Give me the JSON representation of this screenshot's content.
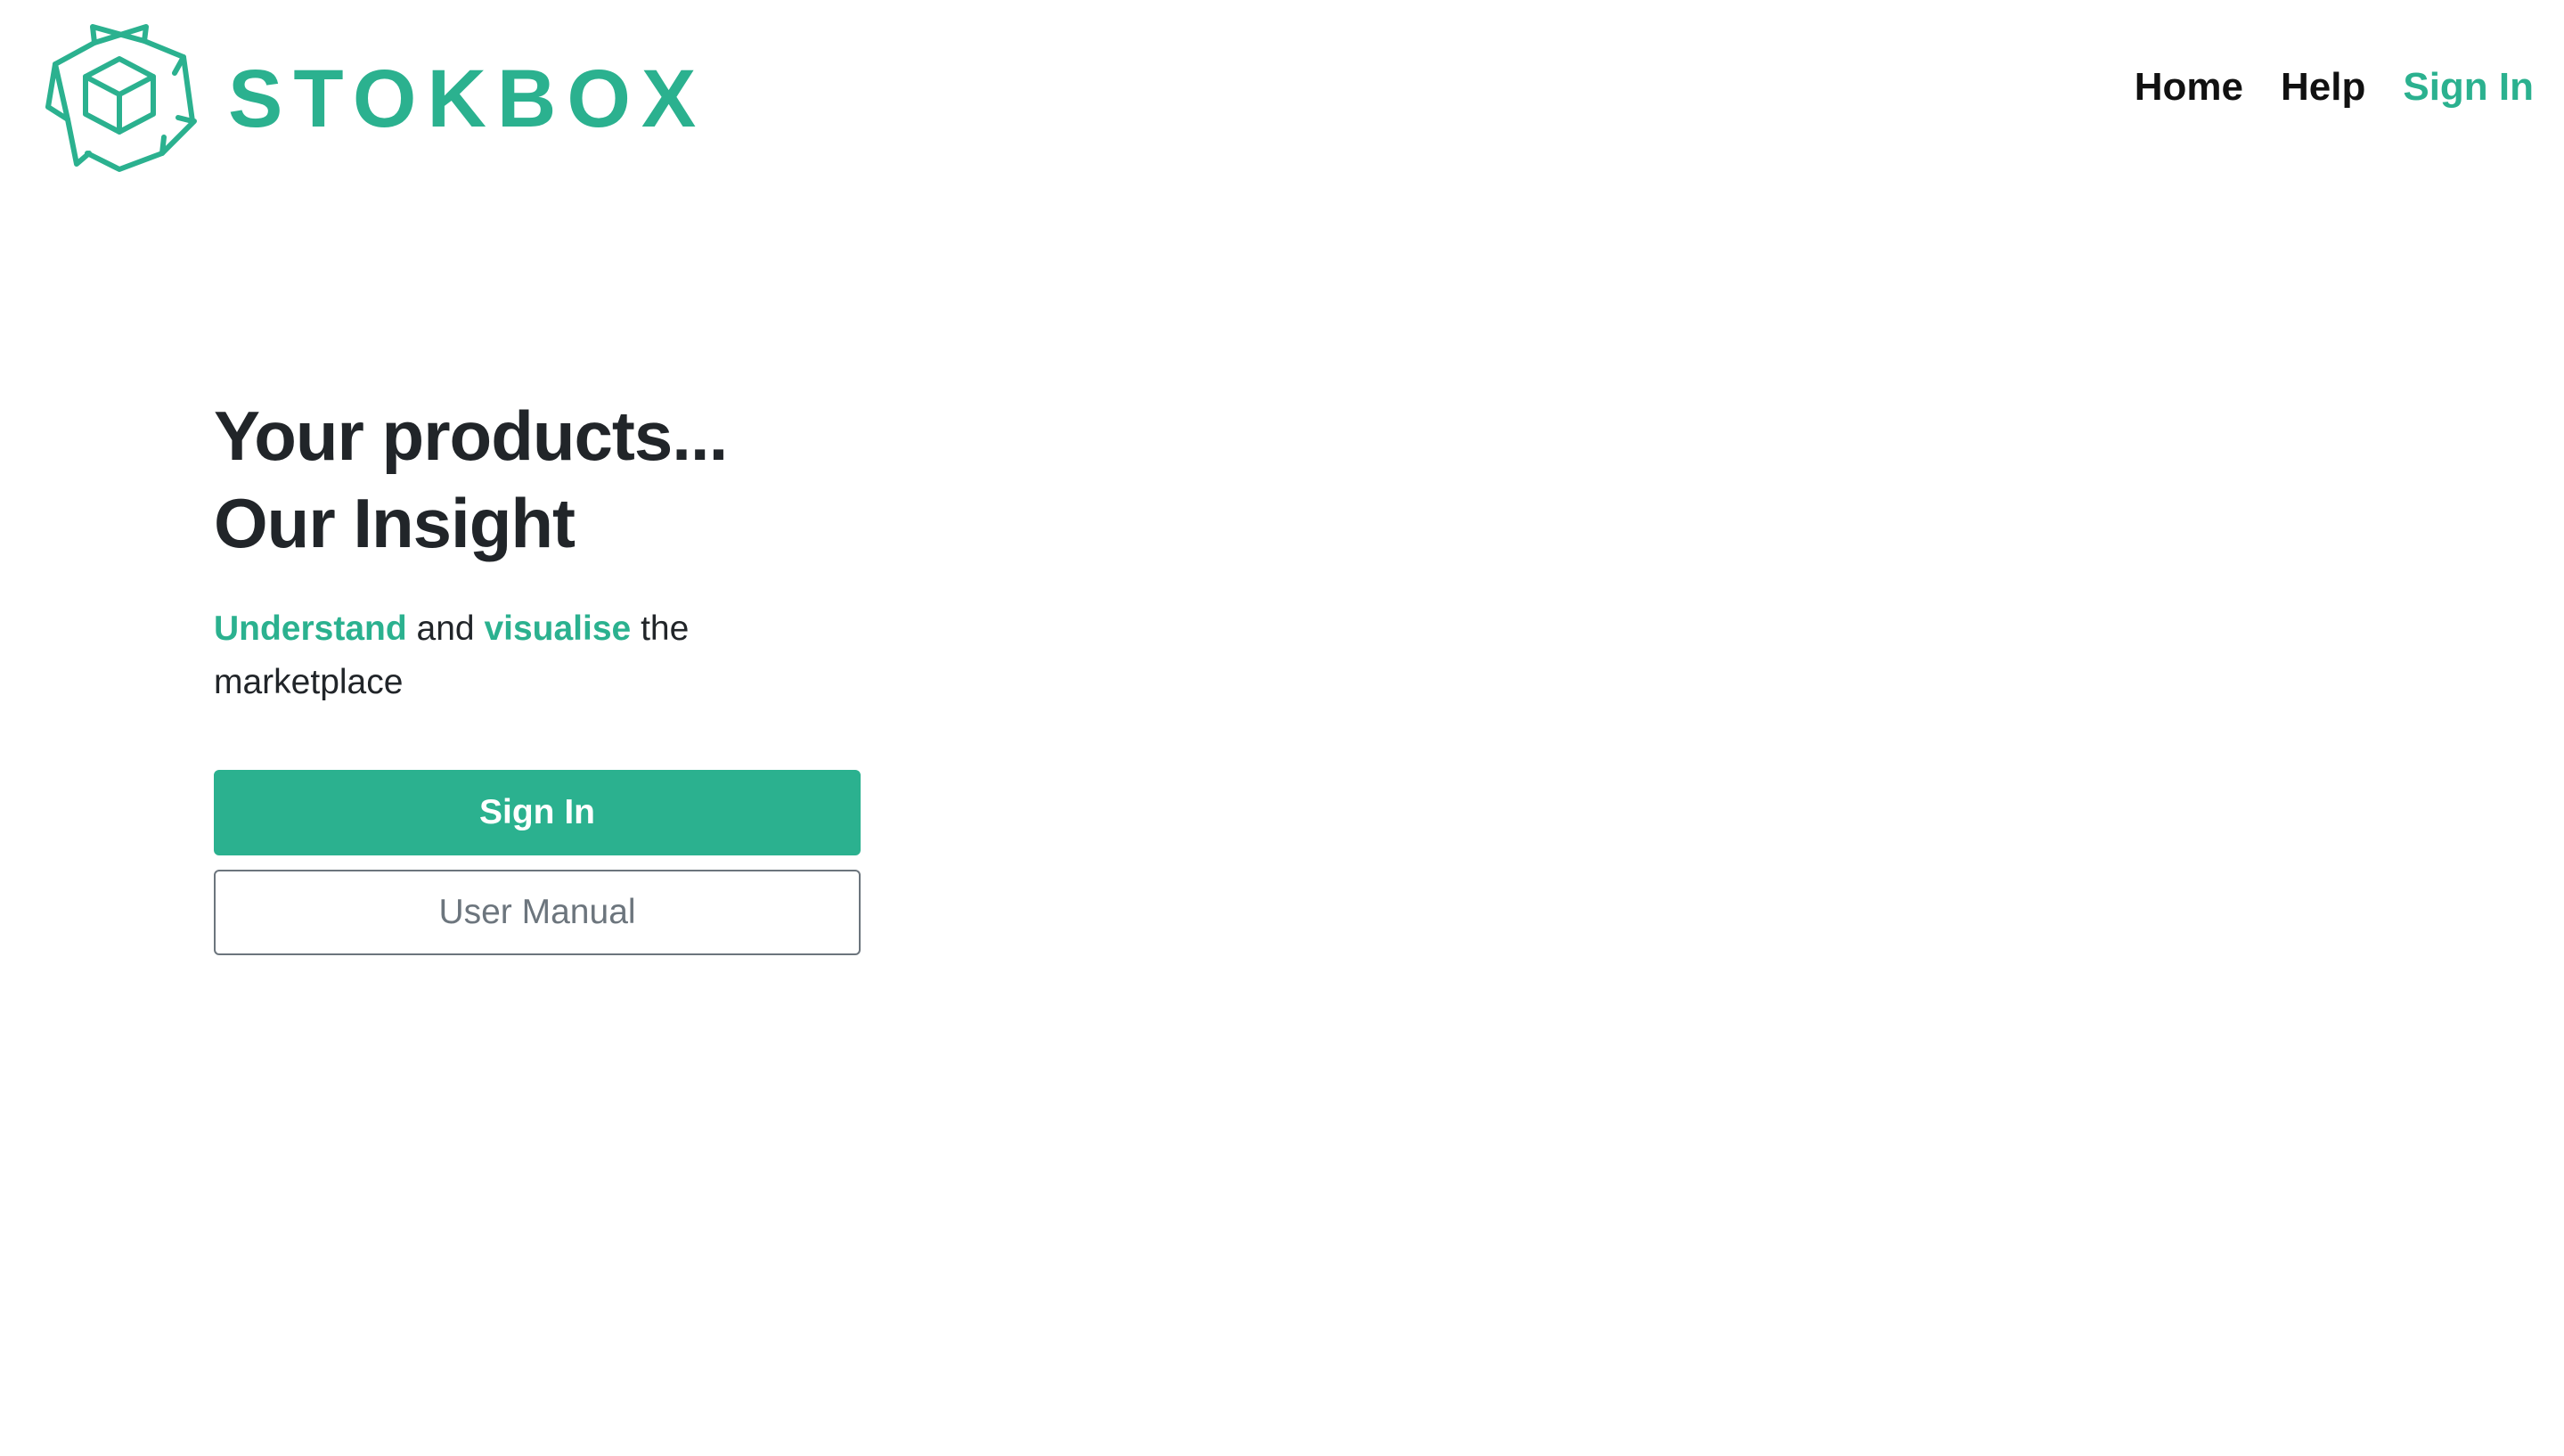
{
  "brand": {
    "name": "STOKBOX",
    "accent_color": "#2bb18f",
    "logo_icon": "recycle-box-icon"
  },
  "nav": {
    "items": [
      {
        "label": "Home"
      },
      {
        "label": "Help"
      },
      {
        "label": "Sign In"
      }
    ]
  },
  "hero": {
    "title_line1": "Your products...",
    "title_line2": "Our Insight",
    "subtitle": {
      "highlight1": "Understand",
      "text1": " and ",
      "highlight2": "visualise",
      "text2": " the marketplace"
    },
    "primary_button": "Sign In",
    "secondary_button": "User Manual"
  }
}
